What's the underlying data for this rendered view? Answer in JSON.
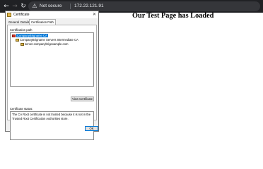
{
  "browser": {
    "security_label": "Not secure",
    "url": "172.22.121.91"
  },
  "page": {
    "heading": "Our Test Page has Loaded"
  },
  "dialog": {
    "title": "Certificate",
    "close_glyph": "✕",
    "tabs": [
      {
        "label": "General"
      },
      {
        "label": "Details"
      },
      {
        "label": "Certification Path"
      }
    ],
    "active_tab": "Certification Path",
    "path_label": "Certification path",
    "tree": [
      {
        "label": "CompanyBrigname CA",
        "selected": true,
        "status": "error"
      },
      {
        "label": "CompanyBrigname Servers Intermediate CA",
        "selected": false,
        "status": "ok"
      },
      {
        "label": "server.companybrigexample.com",
        "selected": false,
        "status": "ok"
      }
    ],
    "view_button_label": "View Certificate",
    "status_label": "Certificate status:",
    "status_text": "The CA Root certificate is not trusted because it is not in the Trusted Root Certification Authorities store.",
    "ok_button_label": "OK"
  },
  "icons": {
    "back": "back-arrow-icon",
    "forward": "forward-arrow-icon",
    "reload": "reload-icon",
    "security": "warning-triangle-icon",
    "certificate": "certificate-icon"
  },
  "colors": {
    "chrome_bg": "#202124",
    "omnibox_bg": "#35363a",
    "selection": "#0078d7",
    "dialog_bg": "#f0f0f0"
  }
}
